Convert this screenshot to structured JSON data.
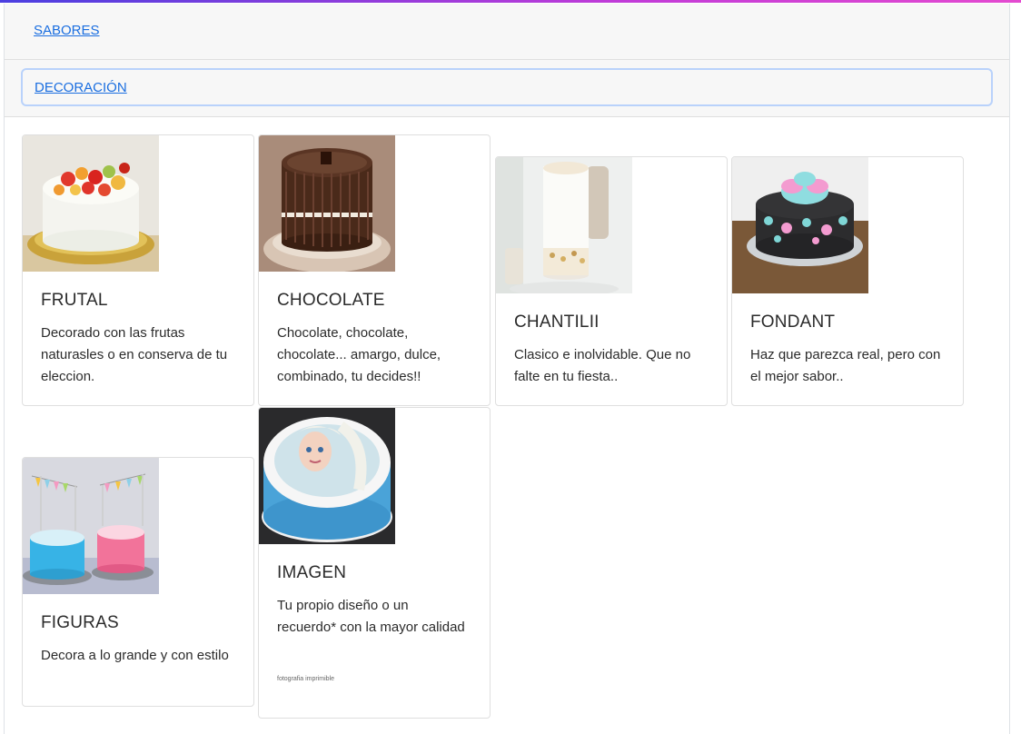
{
  "accordion": {
    "item1_label": "SABORES",
    "item2_label": "DECORACIÓN"
  },
  "cards": [
    {
      "title": "FRUTAL",
      "text": "Decorado con las frutas naturasles o en conserva de tu eleccion.",
      "image": "fruit-cake-image"
    },
    {
      "title": "CHOCOLATE",
      "text": "Chocolate, chocolate, chocolate... amargo, dulce, combinado, tu decides!!",
      "image": "chocolate-cake-image"
    },
    {
      "title": "CHANTILII",
      "text": "Clasico e inolvidable. Que no falte en tu fiesta..",
      "image": "chantilly-cake-image"
    },
    {
      "title": "FONDANT",
      "text": "Haz que parezca real, pero con el mejor sabor..",
      "image": "fondant-cake-image"
    },
    {
      "title": "FIGURAS",
      "text": "Decora a lo grande y con estilo",
      "image": "figures-cake-image"
    },
    {
      "title": "IMAGEN",
      "text": "Tu propio diseño o un recuerdo* con la mayor calidad",
      "small": "fotografia imprimible",
      "image": "printed-image-cake-image"
    }
  ],
  "colors": {
    "link": "#1a6ee0",
    "focus_ring": "#b9d2fb",
    "header_bg": "#f7f7f7"
  }
}
